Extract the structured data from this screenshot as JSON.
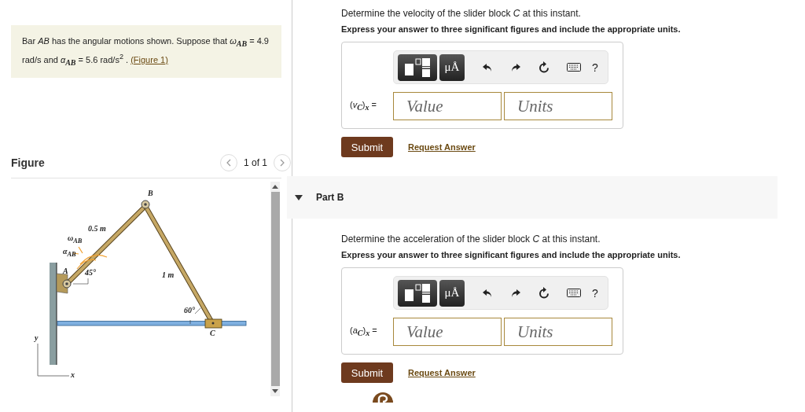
{
  "problem": {
    "intro": "Bar *AB* has the angular motions shown. Suppose that *ω*$_{AB}$ = 4.9 rad/s and *α*$_{AB}$ = 5.6 rad/s$^{2}$ . ",
    "figure_link": "(Figure 1)"
  },
  "figure": {
    "title": "Figure",
    "pager": "1 of 1",
    "labels": [
      {
        "kind": "B",
        "text": "B"
      },
      {
        "kind": "len1",
        "text": "0.5 m"
      },
      {
        "kind": "omega",
        "text": "*ω*$_{AB}$"
      },
      {
        "kind": "alpha",
        "text": "*α*$_{AB}$"
      },
      {
        "kind": "A",
        "text": "A"
      },
      {
        "kind": "ang1",
        "text": "45°"
      },
      {
        "kind": "len2",
        "text": "1 m"
      },
      {
        "kind": "ang2",
        "text": "60°"
      },
      {
        "kind": "C",
        "text": "C"
      },
      {
        "kind": "y",
        "text": "y"
      },
      {
        "kind": "x",
        "text": "x"
      }
    ]
  },
  "parts": [
    {
      "prompt": "Determine the velocity of the slider block *C* at this instant.",
      "instruction": "Express your answer to three significant figures and include the appropriate units.",
      "units_button": "μÅ",
      "help": "?",
      "variable": "(*v*$_{C}$)$_{x}$ =",
      "value_placeholder": "Value",
      "units_placeholder": "Units",
      "submit": "Submit",
      "request": "Request Answer"
    },
    {
      "header": "Part B",
      "expanded": true,
      "prompt": "Determine the acceleration of the slider block *C* at this instant.",
      "instruction": "Express your answer to three significant figures and include the appropriate units.",
      "units_button": "μÅ",
      "help": "?",
      "variable": "(*a*$_{C}$)$_{x}$ =",
      "value_placeholder": "Value",
      "units_placeholder": "Units",
      "submit": "Submit",
      "request": "Request Answer"
    }
  ]
}
